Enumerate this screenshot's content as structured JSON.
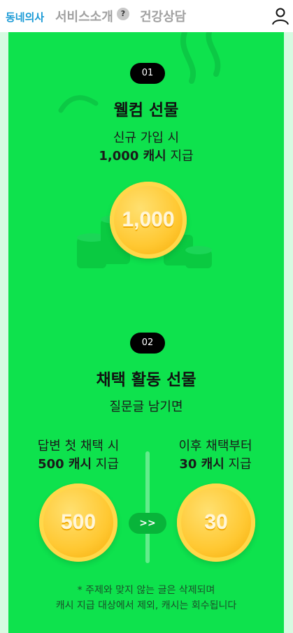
{
  "nav": {
    "brand": "동네의사",
    "service": "서비스소개",
    "help_icon": "?",
    "health": "건강상담",
    "profile_icon": "person-icon"
  },
  "section1": {
    "badge": "01",
    "title": "웰컴 선물",
    "line1": "신규 가입 시",
    "line2_amount": "1,000 캐시",
    "line2_suffix": " 지급",
    "coin": "1,000"
  },
  "section2": {
    "badge": "02",
    "title": "채택 활동 선물",
    "subtitle": "질문글 남기면",
    "left_line1": "답변 첫 채택 시",
    "left_amount": "500 캐시",
    "left_suffix": " 지급",
    "right_line1": "이후 채택부터",
    "right_amount": "30 캐시",
    "right_suffix": " 지급",
    "coin_left": "500",
    "coin_right": "30",
    "arrow": ">>",
    "note_line1": "* 주제와 맞지 않는 글은 삭제되며",
    "note_line2": "캐시 지급 대상에서 제외, 캐시는 회수됩니다"
  },
  "colors": {
    "panel": "#0ee24d",
    "page": "#d6fbe1",
    "brand": "#1a9ad6",
    "coin": "#ffc832"
  }
}
